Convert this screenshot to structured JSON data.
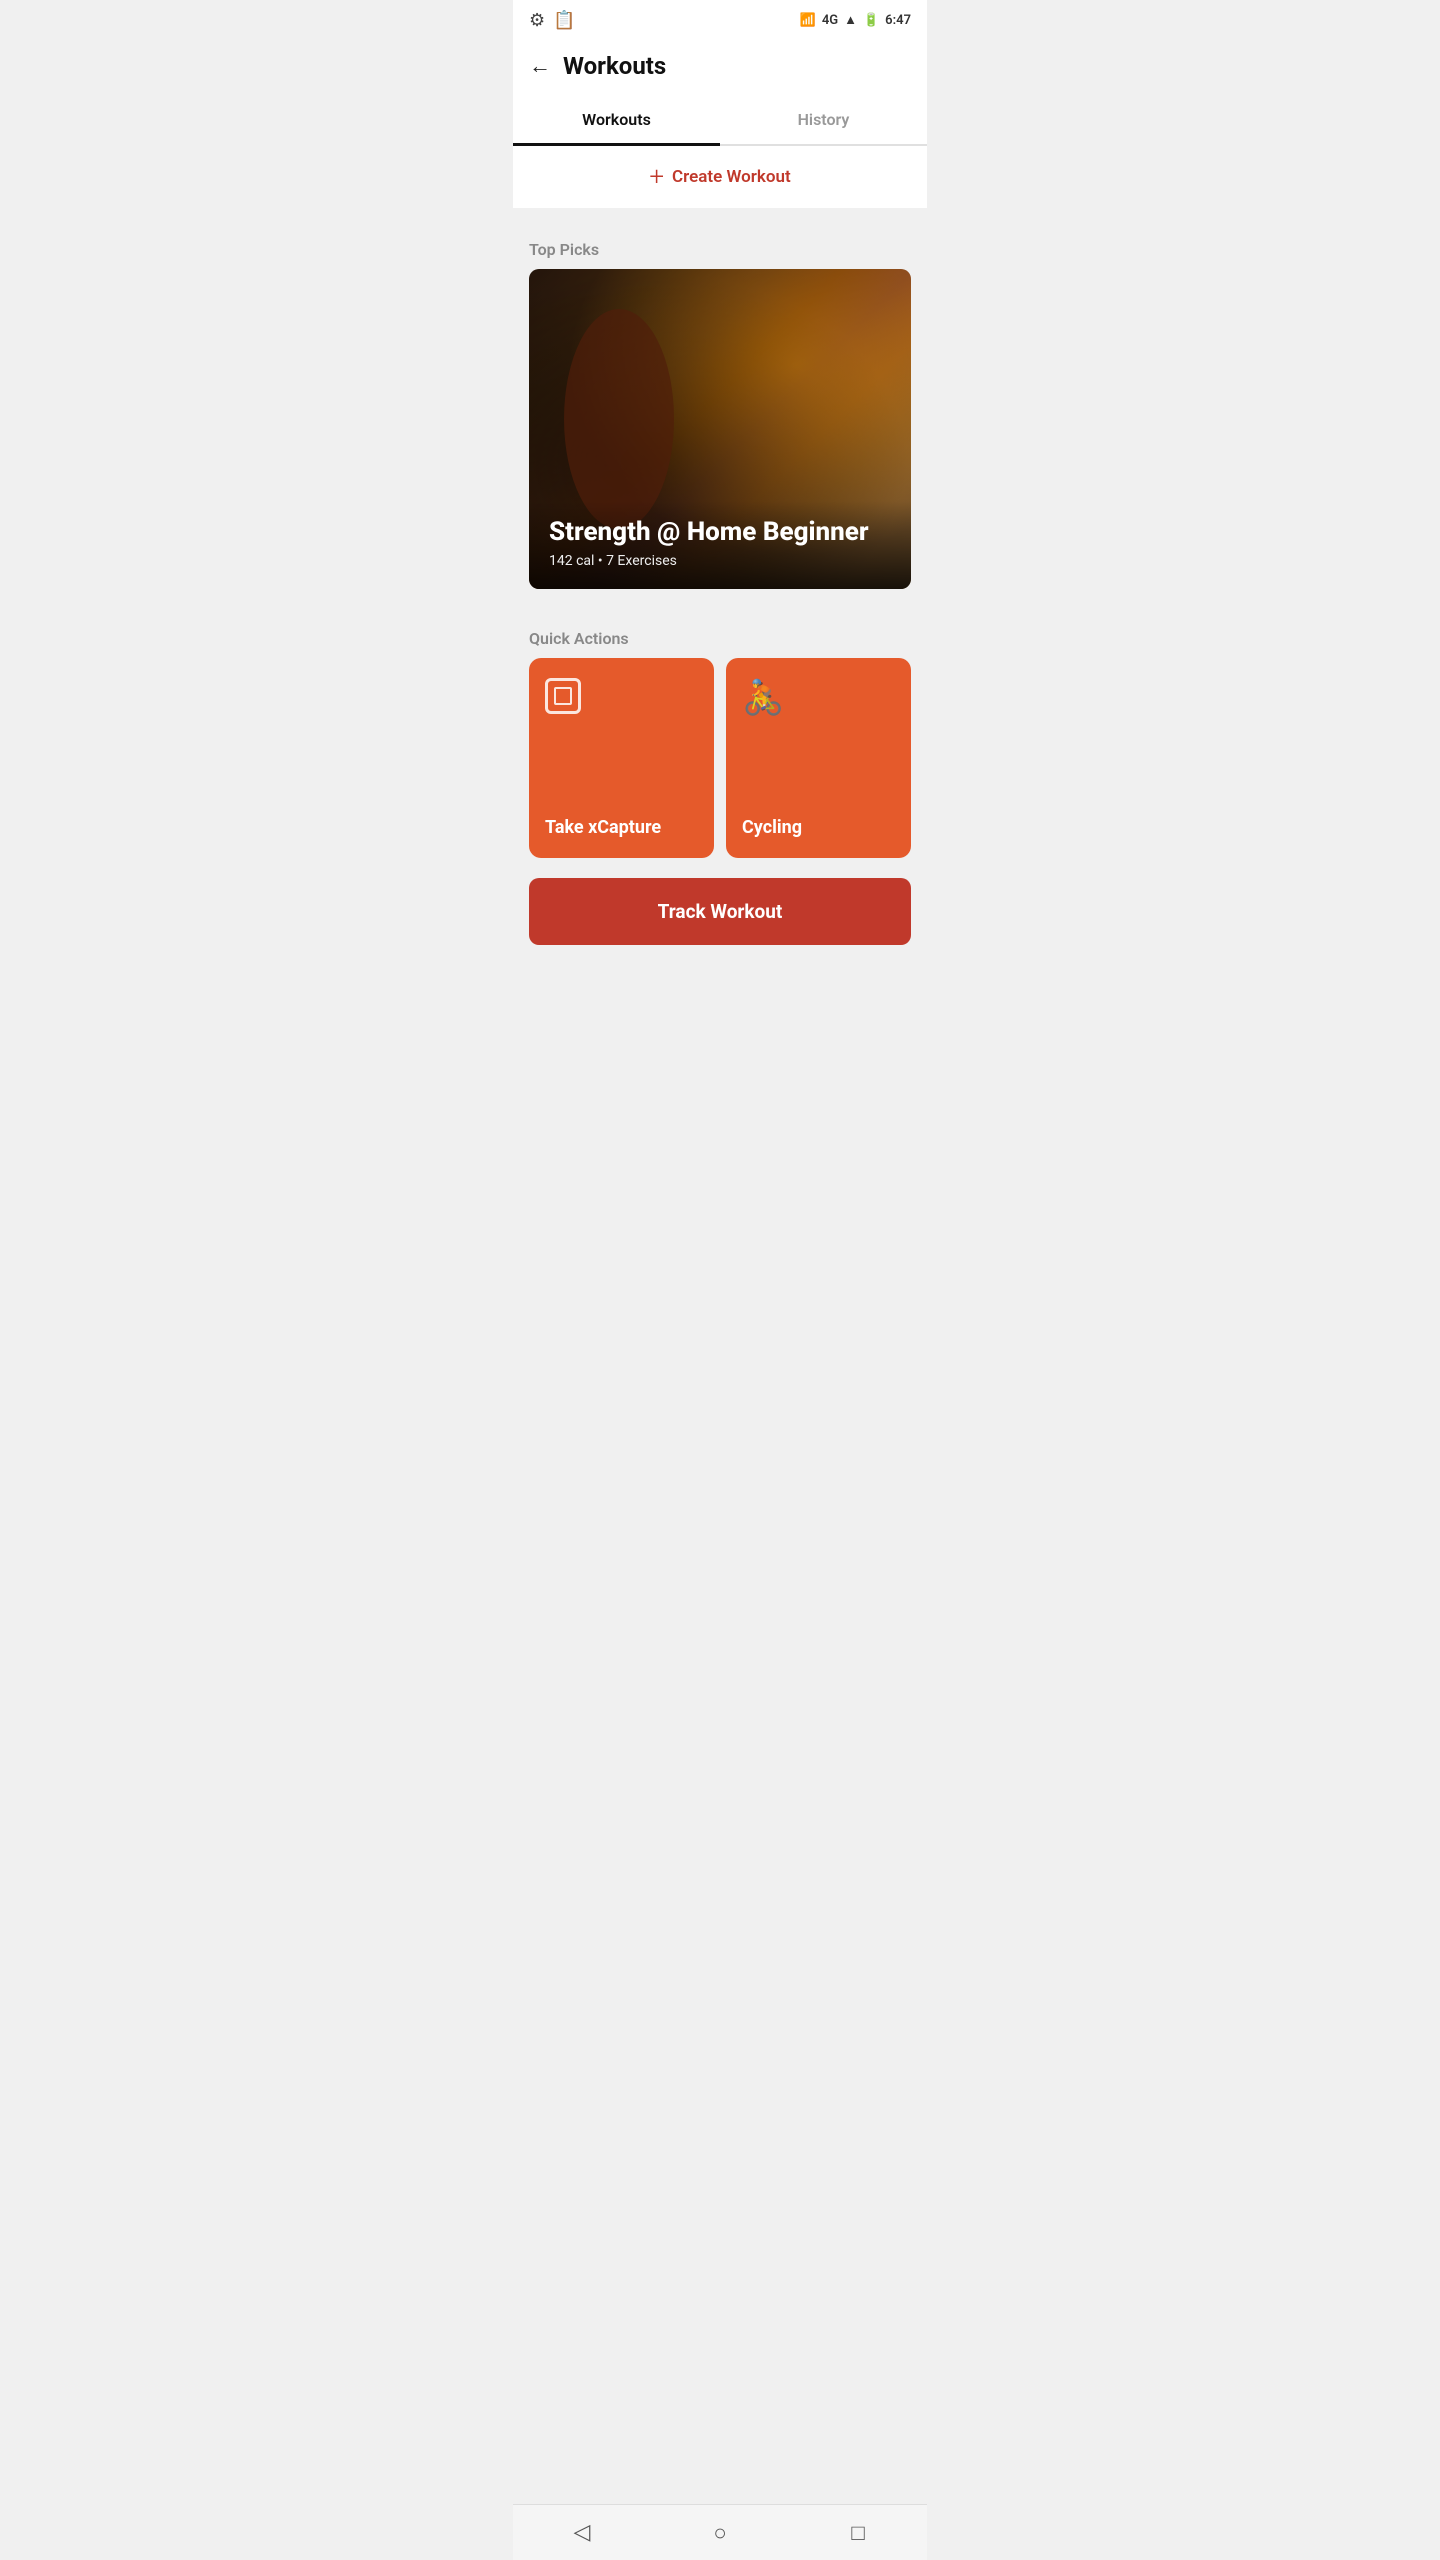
{
  "statusBar": {
    "time": "6:47",
    "bluetooth": "BT",
    "network": "4G",
    "battery": "⚡"
  },
  "header": {
    "backLabel": "←",
    "title": "Workouts"
  },
  "tabs": [
    {
      "id": "workouts",
      "label": "Workouts",
      "active": true
    },
    {
      "id": "history",
      "label": "History",
      "active": false
    }
  ],
  "createWorkout": {
    "plusIcon": "+",
    "label": "Create Workout"
  },
  "topPicks": {
    "sectionLabel": "Top Picks",
    "card": {
      "title": "Strength @ Home Beginner",
      "meta": "142 cal • 7 Exercises"
    }
  },
  "quickActions": {
    "sectionLabel": "Quick Actions",
    "items": [
      {
        "id": "xcapture",
        "label": "Take xCapture",
        "iconType": "scan"
      },
      {
        "id": "cycling",
        "label": "Cycling",
        "iconType": "cycling"
      }
    ]
  },
  "trackWorkout": {
    "label": "Track Workout"
  },
  "bottomNav": {
    "back": "◁",
    "home": "○",
    "square": "□"
  }
}
